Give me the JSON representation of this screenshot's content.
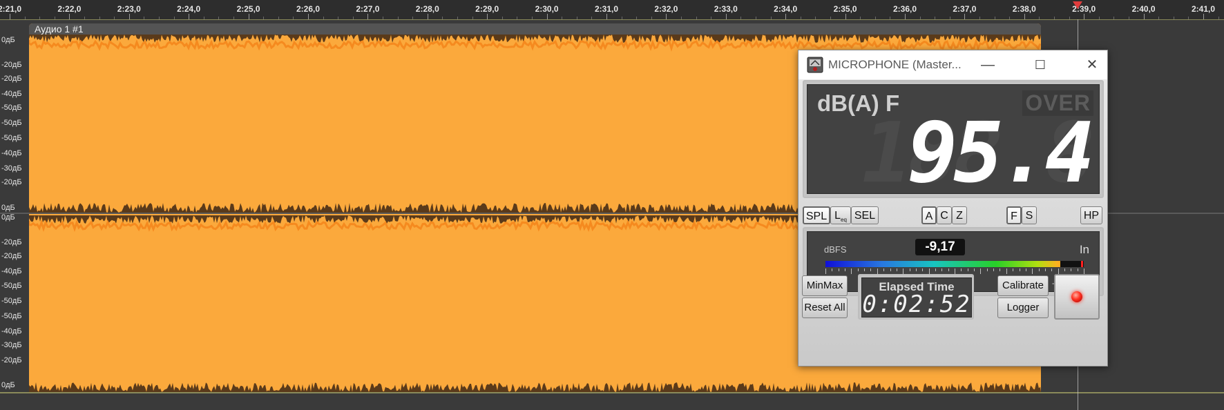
{
  "ruler": {
    "labels": [
      "2:21,0",
      "2:22,0",
      "2:23,0",
      "2:24,0",
      "2:25,0",
      "2:26,0",
      "2:27,0",
      "2:28,0",
      "2:29,0",
      "2:30,0",
      "2:31,0",
      "2:32,0",
      "2:33,0",
      "2:34,0",
      "2:35,0",
      "2:36,0",
      "2:37,0",
      "2:38,0",
      "2:39,0",
      "2:40,0",
      "2:41,0"
    ]
  },
  "db_scale": {
    "labels": [
      "0дБ",
      "-20дБ",
      "-20дБ",
      "-40дБ",
      "-50дБ",
      "-50дБ",
      "-50дБ",
      "-40дБ",
      "-30дБ",
      "-20дБ",
      "0дБ",
      "0дБ",
      "-20дБ",
      "-20дБ",
      "-40дБ",
      "-50дБ",
      "-50дБ",
      "-50дБ",
      "-40дБ",
      "-30дБ",
      "-20дБ",
      "0дБ"
    ]
  },
  "clip": {
    "title": "Аудио 1 #1"
  },
  "colors": {
    "waveform": "#fba93c",
    "waveform_dark": "#f58a1f",
    "background": "#3a3a3a"
  },
  "meter": {
    "window_title": "MICROPHONE (Master...",
    "controls": {
      "minimize": "—",
      "maximize": "☐",
      "close": "✕"
    },
    "weighting": "dB(A) F",
    "over": "OVER",
    "value": "95.4",
    "value_ghost": "188.8",
    "mode_buttons": {
      "spl": "SPL",
      "leq_main": "L",
      "leq_sub": "eq",
      "sel": "SEL"
    },
    "weight_buttons": {
      "a": "A",
      "c": "C",
      "z": "Z"
    },
    "time_buttons": {
      "f": "F",
      "s": "S"
    },
    "hp": "HP",
    "dbfs": {
      "label": "dBFS",
      "value": "-9,17",
      "input": "In",
      "level": -9.17,
      "scale": [
        "-100",
        "-70",
        "-50",
        "-30",
        "-10",
        "0"
      ]
    },
    "minmax": "MinMax",
    "reset_all": "Reset All",
    "elapsed_label": "Elapsed Time",
    "elapsed_value": "0:02:52",
    "calibrate": "Calibrate",
    "logger": "Logger"
  }
}
